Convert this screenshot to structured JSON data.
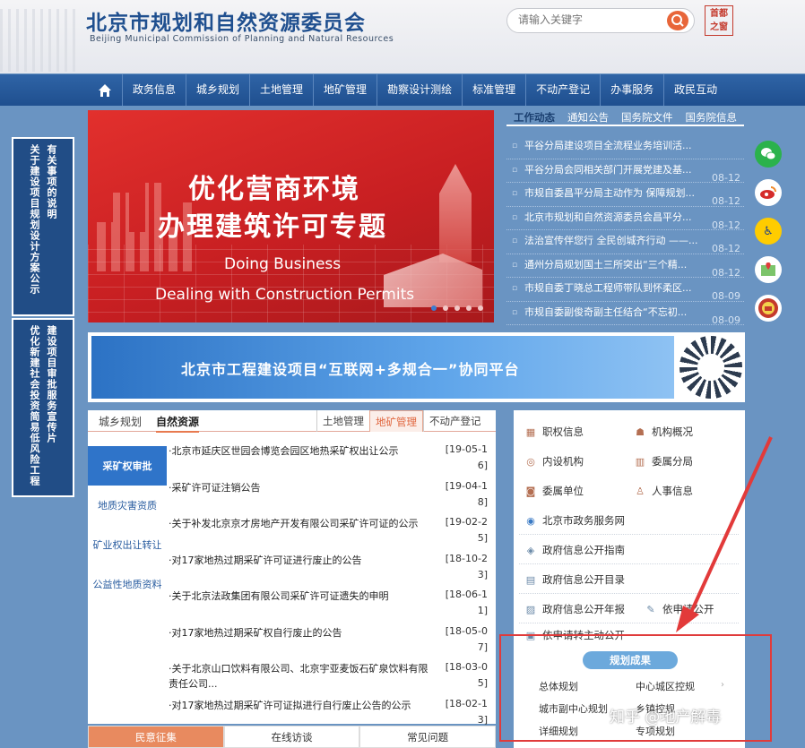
{
  "header": {
    "title": "北京市规划和自然资源委员会",
    "subtitle": "Beijing Municipal Commission of Planning and Natural Resources",
    "search_placeholder": "请输入关键字",
    "logo_text": "首都之窗"
  },
  "nav": {
    "home_icon": "home-icon",
    "items": [
      "政务信息",
      "城乡规划",
      "土地管理",
      "地矿管理",
      "勘察设计测绘",
      "标准管理",
      "不动产登记",
      "办事服务",
      "政民互动"
    ]
  },
  "left_links": [
    {
      "col1": "关于建设项目规划设计方案公示",
      "col2": "有关事项的说明"
    },
    {
      "col1": "优化新建社会投资简易低风险工程",
      "col2": "建设项目审批服务宣传片"
    }
  ],
  "banner": {
    "cn_line1": "优化营商环境",
    "cn_line2": "办理建筑许可专题",
    "en_line1": "Doing Business",
    "en_line2": "Dealing with Construction Permits",
    "active_slide": 1,
    "slide_count": 5
  },
  "news": {
    "tabs": [
      "工作动态",
      "通知公告",
      "国务院文件",
      "国务院信息"
    ],
    "items": [
      {
        "title": "平谷分局建设项目全流程业务培训活...",
        "date": ""
      },
      {
        "title": "平谷分局会同相关部门开展党建及基...",
        "date": "08-12"
      },
      {
        "title": "市规自委昌平分局主动作为 保障规划...",
        "date": "08-12"
      },
      {
        "title": "北京市规划和自然资源委员会昌平分...",
        "date": "08-12"
      },
      {
        "title": "法治宣传伴您行 全民创城齐行动 ——...",
        "date": "08-12"
      },
      {
        "title": "通州分局规划国土三所突出“三个精...",
        "date": "08-12"
      },
      {
        "title": "市规自委丁晓总工程师带队到怀柔区...",
        "date": "08-09"
      },
      {
        "title": "市规自委副俊奇副主任结合“不忘初...",
        "date": "08-09"
      }
    ]
  },
  "social": [
    "wechat-icon",
    "weibo-icon",
    "accessibility-icon",
    "map-icon",
    "emblem-icon"
  ],
  "platform": {
    "text": "北京市工程建设项目“互联网+多规合一”协同平台"
  },
  "land": {
    "tabs_left": [
      "城乡规划",
      "自然资源"
    ],
    "tabs_right": [
      "土地管理",
      "地矿管理",
      "不动产登记"
    ],
    "categories": [
      "采矿权审批",
      "地质灾害资质",
      "矿业权出让转让",
      "公益性地质资料"
    ],
    "notices": [
      {
        "text": "·北京市延庆区世园会博览会园区地热采矿权出让公示",
        "date": "[19-05-16]"
      },
      {
        "text": "·采矿许可证注销公告",
        "date": "[19-04-18]"
      },
      {
        "text": "·关于补发北京京才房地产开发有限公司采矿许可证的公示",
        "date": "[19-02-25]"
      },
      {
        "text": "·对17家地热过期采矿许可证进行废止的公告",
        "date": "[18-10-23]"
      },
      {
        "text": "·关于北京法政集团有限公司采矿许可证遗失的申明",
        "date": "[18-06-11]"
      },
      {
        "text": "·对17家地热过期采矿权自行废止的公告",
        "date": "[18-05-07]"
      },
      {
        "text": "·关于北京山口饮料有限公司、北京宇亚麦饭石矿泉饮料有限责任公司...",
        "date": "[18-03-05]"
      },
      {
        "text": "·对17家地热过期采矿许可证拟进行自行废止公告的公示",
        "date": "[18-02-13]"
      }
    ]
  },
  "bottom_tabs": [
    "民意征集",
    "在线访谈",
    "常见问题"
  ],
  "services": {
    "grid": [
      [
        "职权信息",
        "机构概况"
      ],
      [
        "内设机构",
        "委属分局"
      ],
      [
        "委属单位",
        "人事信息"
      ]
    ],
    "gov_service": "北京市政务服务网",
    "list": [
      "政府信息公开指南",
      "政府信息公开目录",
      "政府信息公开年报",
      "依申请公开",
      "依申请转主动公开"
    ]
  },
  "plan": {
    "title": "规划成果",
    "links": [
      [
        "总体规划",
        "中心城区控规"
      ],
      [
        "城市副中心规划",
        "乡镇控规"
      ],
      [
        "详细规划",
        "专项规划"
      ]
    ]
  },
  "watermark": "知乎 @地产解毒"
}
